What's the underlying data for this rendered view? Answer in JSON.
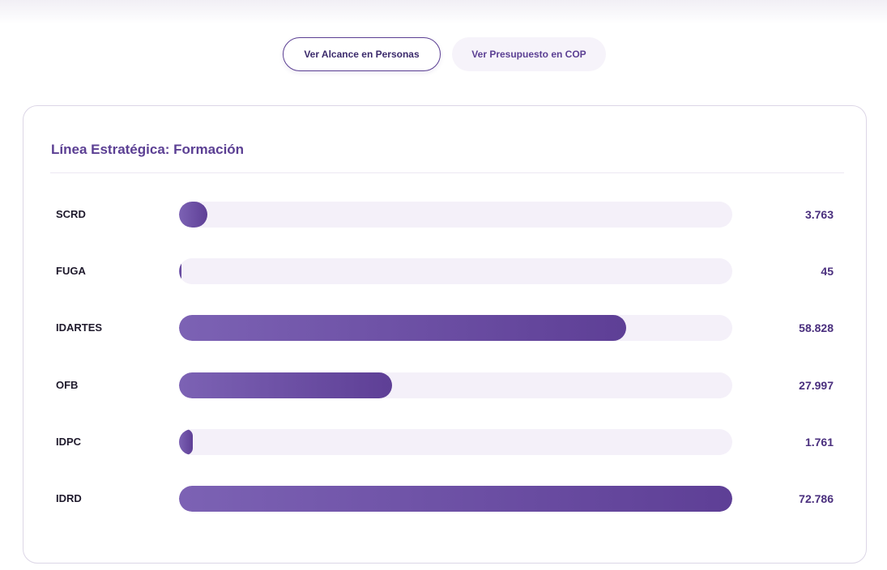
{
  "toggles": [
    {
      "label": "Ver Alcance en Personas",
      "active": true
    },
    {
      "label": "Ver Presupuesto en COP",
      "active": false
    }
  ],
  "card": {
    "title": "Línea Estratégica: Formación"
  },
  "colors": {
    "accent": "#5b3f93",
    "bar_start": "#7c62b4",
    "bar_end": "#5e3f96",
    "track": "#f4f0f9"
  },
  "chart_data": {
    "type": "bar",
    "orientation": "horizontal",
    "categories": [
      "SCRD",
      "FUGA",
      "IDARTES",
      "OFB",
      "IDPC",
      "IDRD"
    ],
    "values": [
      3763,
      45,
      58828,
      27997,
      1761,
      72786
    ],
    "value_labels": [
      "3.763",
      "45",
      "58.828",
      "27.997",
      "1.761",
      "72.786"
    ],
    "title": "Línea Estratégica: Formación",
    "xlim": [
      0,
      72786
    ]
  }
}
